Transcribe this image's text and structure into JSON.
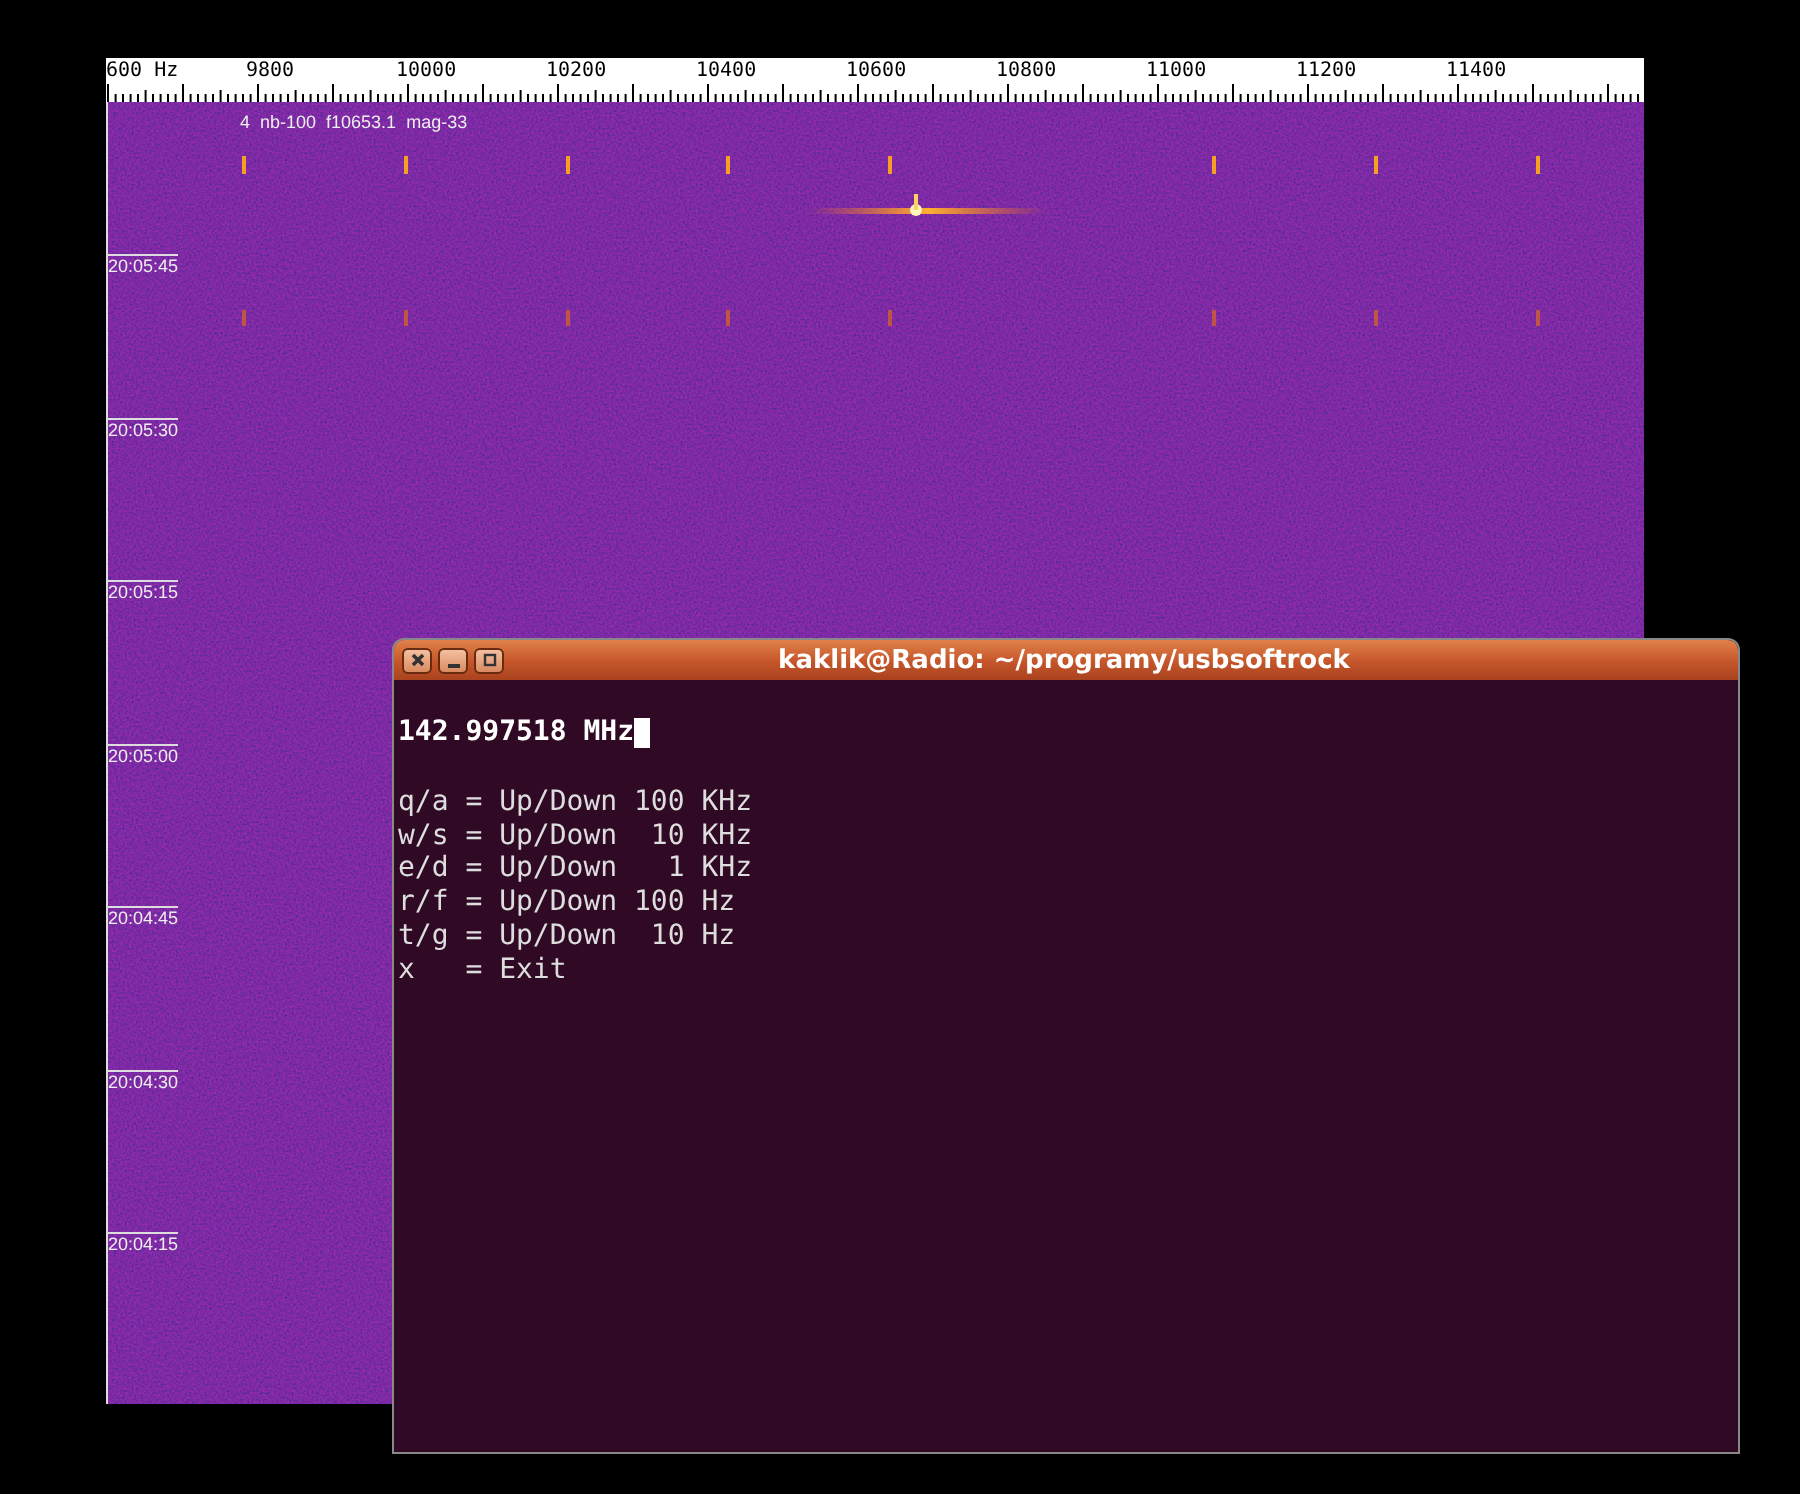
{
  "spectrogram": {
    "ruler_labels": [
      "600 Hz",
      "9800",
      "10000",
      "10200",
      "10400",
      "10600",
      "10800",
      "11000",
      "11200",
      "11400"
    ],
    "info": "4  nb-100  f10653.1  mag-33",
    "time_labels": [
      "20:05:45",
      "20:05:30",
      "20:05:15",
      "20:05:00",
      "20:04:45",
      "20:04:30",
      "20:04:15"
    ]
  },
  "terminal": {
    "title": "kaklik@Radio: ~/programy/usbsoftrock",
    "frequency": "142.997518 MHz",
    "lines": [
      "q/a = Up/Down 100 KHz",
      "w/s = Up/Down  10 KHz",
      "e/d = Up/Down   1 KHz",
      "r/f = Up/Down 100 Hz",
      "t/g = Up/Down  10 Hz",
      "x   = Exit"
    ]
  }
}
